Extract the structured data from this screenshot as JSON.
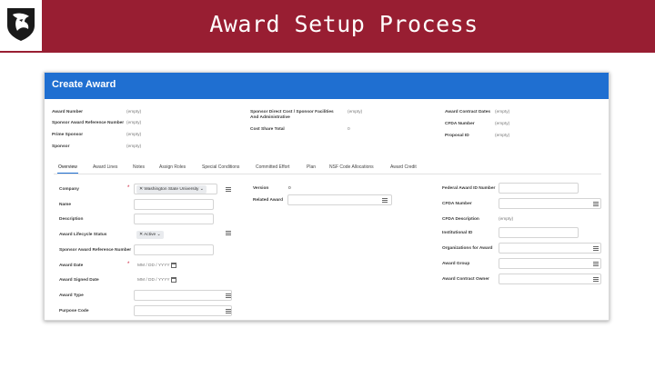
{
  "slide": {
    "title": "Award Setup Process"
  },
  "window": {
    "title": "Create Award"
  },
  "summary": {
    "col1": [
      {
        "label": "Award Number",
        "value": "(empty)"
      },
      {
        "label": "Sponsor Award Reference Number",
        "value": "(empty)"
      },
      {
        "label": "Prime Sponsor",
        "value": "(empty)"
      },
      {
        "label": "Sponsor",
        "value": "(empty)"
      }
    ],
    "col2": [
      {
        "label": "Sponsor Direct Cost / Sponsor Facilities And Administrative",
        "value": "(empty)"
      },
      {
        "label": "Cost Share Total",
        "value": "0"
      }
    ],
    "col3": [
      {
        "label": "Award Contract Dates",
        "value": "(empty)"
      },
      {
        "label": "CFDA Number",
        "value": "(empty)"
      },
      {
        "label": "Proposal ID",
        "value": "(empty)"
      }
    ]
  },
  "tabs": [
    {
      "label": "Overview",
      "active": true
    },
    {
      "label": "Award Lines",
      "active": false
    },
    {
      "label": "Notes",
      "active": false
    },
    {
      "label": "Assign Roles",
      "active": false
    },
    {
      "label": "Special Conditions",
      "active": false
    },
    {
      "label": "Committed Effort",
      "active": false
    },
    {
      "label": "Plan",
      "active": false
    },
    {
      "label": "NSF Code Allocations",
      "active": false
    },
    {
      "label": "Award Credit",
      "active": false
    }
  ],
  "form_left": {
    "company": {
      "label": "Company",
      "value": "Washington State University"
    },
    "name": {
      "label": "Name"
    },
    "description": {
      "label": "Description"
    },
    "lifecycle": {
      "label": "Award Lifecycle Status",
      "value": "Active"
    },
    "sponsor_ref": {
      "label": "Sponsor Award Reference Number"
    },
    "award_date": {
      "label": "Award Date",
      "placeholder": "MM / DD / YYYY"
    },
    "signed_date": {
      "label": "Award Signed Date",
      "placeholder": "MM / DD / YYYY"
    },
    "award_type": {
      "label": "Award Type"
    },
    "purpose_code": {
      "label": "Purpose Code"
    }
  },
  "form_mid": {
    "version": {
      "label": "Version",
      "value": "0"
    },
    "related_award": {
      "label": "Related Award"
    }
  },
  "form_right": {
    "federal_award_id": {
      "label": "Federal Award ID Number"
    },
    "cfda_number": {
      "label": "CFDA Number"
    },
    "cfda_description": {
      "label": "CFDA Description",
      "value": "(empty)"
    },
    "institutional_id": {
      "label": "Institutional ID"
    },
    "organizations": {
      "label": "Organizations for Award"
    },
    "award_group": {
      "label": "Award Group"
    },
    "contract_owner": {
      "label": "Award Contract Owner"
    }
  },
  "icons": {
    "logo": "cougar-head-icon",
    "prompt": "menu-icon",
    "calendar": "calendar-icon",
    "remove": "close-icon",
    "dropdown": "chevron-down-icon"
  },
  "colors": {
    "banner": "#981e32",
    "header": "#1f6fd1",
    "required": "#c8102e"
  }
}
